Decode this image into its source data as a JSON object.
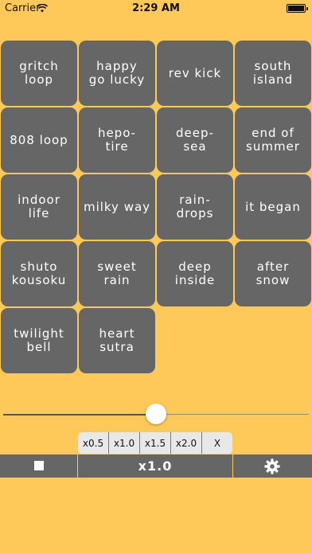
{
  "status_bar": {
    "carrier": "Carrier",
    "time": "2:29 AM"
  },
  "pads": [
    {
      "label": "gritch\nloop"
    },
    {
      "label": "happy\ngo lucky"
    },
    {
      "label": "rev kick"
    },
    {
      "label": "south\nisland"
    },
    {
      "label": "808 loop"
    },
    {
      "label": "hepo-\ntire"
    },
    {
      "label": "deep-\nsea"
    },
    {
      "label": "end of\nsummer"
    },
    {
      "label": "indoor\nlife"
    },
    {
      "label": "milky way"
    },
    {
      "label": "rain-\ndrops"
    },
    {
      "label": "it began"
    },
    {
      "label": "shuto\nkousoku"
    },
    {
      "label": "sweet\nrain"
    },
    {
      "label": "deep\ninside"
    },
    {
      "label": "after\nsnow"
    },
    {
      "label": "twilight\nbell"
    },
    {
      "label": "heart\nsutra"
    }
  ],
  "slider": {
    "value": 0.5
  },
  "speed_popup": {
    "options": [
      "x0.5",
      "x1.0",
      "x1.5",
      "x2.0"
    ],
    "close_label": "X"
  },
  "bottom_bar": {
    "rate_label": "x1.0",
    "stop_icon": "stop-icon",
    "settings_icon": "gear-icon"
  },
  "colors": {
    "background": "#ffc959",
    "pad": "#666666",
    "popup": "#e8e8e8"
  }
}
